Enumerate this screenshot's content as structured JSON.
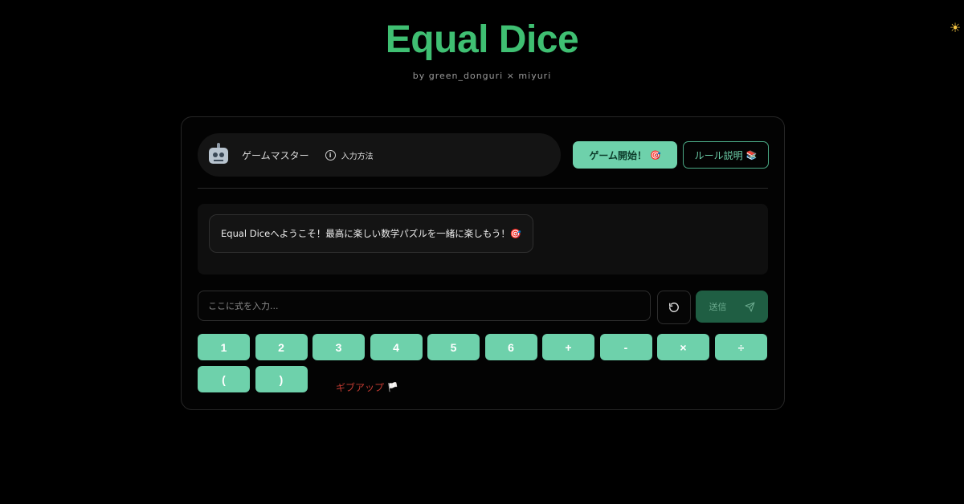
{
  "header": {
    "title": "Equal Dice",
    "subtitle": "by green_donguri × miyuri"
  },
  "theme_icon": "sun-icon",
  "game_master": {
    "avatar_icon": "robot-icon",
    "name": "ゲームマスター",
    "help_label": "入力方法"
  },
  "actions": {
    "start_label": "ゲーム開始！",
    "start_emoji": "🎯",
    "rules_label": "ルール説明",
    "rules_emoji": "📚"
  },
  "chat": {
    "messages": [
      {
        "text": "Equal Diceへようこそ！最高に楽しい数学パズルを一緒に楽しもう！🎯"
      }
    ]
  },
  "input": {
    "placeholder": "ここに式を入力...",
    "value": "",
    "send_label": "送信"
  },
  "keypad": {
    "keys": [
      "1",
      "2",
      "3",
      "4",
      "5",
      "6",
      "+",
      "-",
      "×",
      "÷",
      "(",
      ")"
    ]
  },
  "giveup": {
    "label": "ギブアップ",
    "emoji": "🏳️"
  },
  "colors": {
    "accent": "#3fbf72",
    "key": "#6ed1ab",
    "send": "#1f5e43",
    "giveup": "#c23b32",
    "background": "#000000"
  }
}
